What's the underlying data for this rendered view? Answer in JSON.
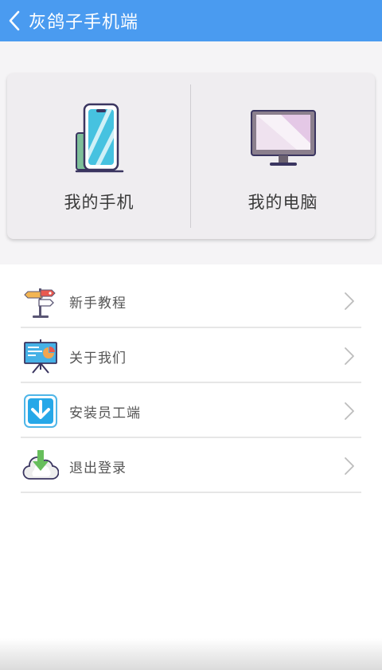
{
  "header": {
    "title": "灰鸽子手机端",
    "back_icon": "chevron-left-icon",
    "color": "#4a9bf0"
  },
  "devices": [
    {
      "label": "我的手机",
      "icon": "phone-icon"
    },
    {
      "label": "我的电脑",
      "icon": "monitor-icon"
    }
  ],
  "menu": {
    "items": [
      {
        "label": "新手教程",
        "icon": "signpost-icon"
      },
      {
        "label": "关于我们",
        "icon": "presentation-board-icon"
      },
      {
        "label": "安装员工端",
        "icon": "download-icon"
      },
      {
        "label": "退出登录",
        "icon": "cloud-download-icon"
      }
    ]
  }
}
